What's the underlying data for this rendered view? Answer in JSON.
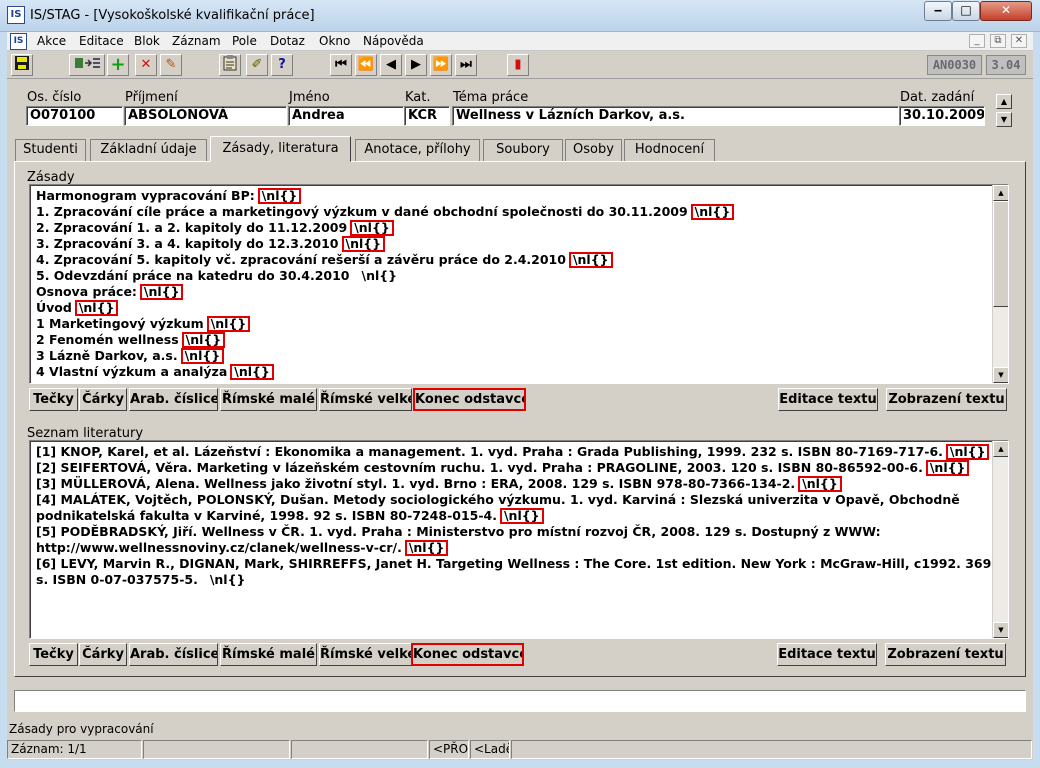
{
  "window": {
    "title": "IS/STAG - [Vysokoškolské kvalifikační práce]",
    "min": "‒",
    "max": "□",
    "close": "✕"
  },
  "menu": [
    "Akce",
    "Editace",
    "Blok",
    "Záznam",
    "Pole",
    "Dotaz",
    "Okno",
    "Nápověda"
  ],
  "mdi_controls": [
    "_",
    "⧉",
    "✕"
  ],
  "toolbar": {
    "icons": [
      "save-icon",
      "query-icon",
      "add-icon",
      "delete-icon",
      "clear-icon",
      "clipboard-icon",
      "edit-icon",
      "help-icon",
      "first-record-icon",
      "prev-page-icon",
      "prev-record-icon",
      "next-record-icon",
      "next-page-icon",
      "last-record-icon",
      "exit-icon"
    ],
    "indicator_code": "AN0030",
    "indicator_version": "3.04"
  },
  "header": {
    "os_cislo": {
      "label": "Os. číslo",
      "value": "O070100"
    },
    "prijmeni": {
      "label": "Příjmení",
      "value": "ABSOLONOVÁ"
    },
    "jmeno": {
      "label": "Jméno",
      "value": "Andrea"
    },
    "kat": {
      "label": "Kat.",
      "value": "KCR"
    },
    "tema": {
      "label": "Téma práce",
      "value": "Wellness v Lázních Darkov, a.s."
    },
    "datum": {
      "label": "Dat. zadání",
      "value": "30.10.2009"
    }
  },
  "tabs": [
    "Studenti",
    "Základní údaje",
    "Zásady, literatura",
    "Anotace, přílohy",
    "Soubory",
    "Osoby",
    "Hodnocení"
  ],
  "active_tab": "Zásady, literatura",
  "zasady": {
    "label": "Zásady",
    "nl_marker": "\\nl{}",
    "lines": [
      {
        "text": "Harmonogram vypracování BP:",
        "boxed": true
      },
      {
        "text": "1. Zpracování cíle práce a marketingový výzkum v dané obchodní společnosti do 30.11.2009",
        "boxed": true
      },
      {
        "text": "2. Zpracování 1. a 2. kapitoly do 11.12.2009",
        "boxed": true
      },
      {
        "text": "3. Zpracování 3. a 4. kapitoly do 12.3.2010",
        "boxed": true
      },
      {
        "text": "4. Zpracování 5. kapitoly vč. zpracování rešerší a závěru práce do 2.4.2010",
        "boxed": true
      },
      {
        "text": "5. Odevzdání práce na katedru do 30.4.2010",
        "boxed": false
      },
      {
        "text": "Osnova práce:",
        "boxed": true
      },
      {
        "text": "Úvod",
        "boxed": true
      },
      {
        "text": "1 Marketingový výzkum",
        "boxed": true
      },
      {
        "text": "2 Fenomén wellness",
        "boxed": true
      },
      {
        "text": "3 Lázně Darkov, a.s.",
        "boxed": true
      },
      {
        "text": "4 Vlastní výzkum a analýza",
        "boxed": true
      }
    ]
  },
  "literatura": {
    "label": "Seznam literatury",
    "lines": [
      {
        "text": "[1] KNOP, Karel, et al. Lázeňství : Ekonomika a management. 1. vyd. Praha : Grada Publishing, 1999. 232 s. ISBN 80-7169-717-6.",
        "boxed": true
      },
      {
        "text": "[2] SEIFERTOVÁ, Věra. Marketing v lázeňském cestovním ruchu. 1. vyd. Praha : PRAGOLINE, 2003. 120 s. ISBN 80-86592-00-6.",
        "boxed": true
      },
      {
        "text": "[3] MÜLLEROVÁ, Alena. Wellness jako životní styl. 1. vyd. Brno : ERA, 2008. 129 s. ISBN 978-80-7366-134-2.",
        "boxed": true
      },
      {
        "text": "[4] MALÁTEK, Vojtěch, POLONSKÝ, Dušan. Metody sociologického výzkumu. 1. vyd. Karviná : Slezská univerzita v Opavě, Obchodně",
        "boxed": false
      },
      {
        "text": "podnikatelská fakulta v Karviné, 1998. 92 s. ISBN 80-7248-015-4.",
        "boxed": true
      },
      {
        "text": "[5] PODĚBRADSKÝ, Jiří. Wellness v ČR. 1. vyd. Praha : Ministerstvo pro místní rozvoj ČR, 2008. 129 s. Dostupný z WWW:",
        "boxed": false
      },
      {
        "text": "http://www.wellnessnoviny.cz/clanek/wellness-v-cr/.",
        "boxed": true
      },
      {
        "text": "[6] LEVY, Marvin R., DIGNAN, Mark, SHIRREFFS, Janet H. Targeting Wellness : The Core. 1st edition. New York : McGraw-Hill, c1992. 369",
        "boxed": false
      },
      {
        "text": "s. ISBN 0-07-037575-5.",
        "boxed": false
      }
    ]
  },
  "format_buttons": [
    "Tečky",
    "Čárky",
    "Arab. číslice",
    "Římské malé",
    "Římské velké",
    "Konec odstavce"
  ],
  "edit_button": "Editace textu",
  "view_button": "Zobrazení textu",
  "hint": "Zásady pro vypracování",
  "status": {
    "record": "Záznam: 1/1",
    "mode1": "<PŘOS",
    "mode2": "<Ladě"
  }
}
